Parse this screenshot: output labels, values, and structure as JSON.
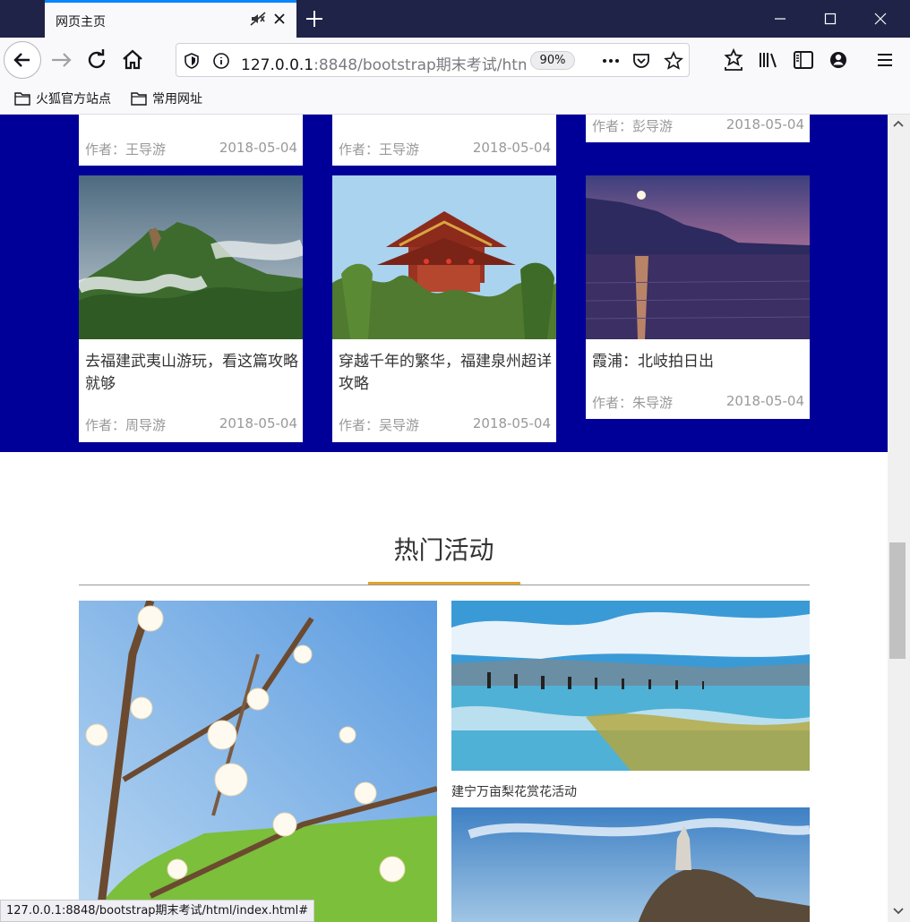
{
  "browser": {
    "tab_title": "网页主页",
    "url_host": "127.0.0.1",
    "url_rest": ":8848/bootstrap期末考试/htm",
    "zoom": "90%",
    "bookmarks": [
      "火狐官方站点",
      "常用网址"
    ],
    "status_url": "127.0.0.1:8848/bootstrap期末考试/html/index.html#"
  },
  "articles_top": [
    {
      "author": "作者：王导游",
      "date": "2018-05-04"
    },
    {
      "author": "作者：王导游",
      "date": "2018-05-04"
    },
    {
      "author": "作者：彭导游",
      "date": "2018-05-04"
    }
  ],
  "articles": [
    {
      "title": "去福建武夷山游玩，看这篇攻略就够",
      "author": "作者：周导游",
      "date": "2018-05-04"
    },
    {
      "title": "穿越千年的繁华，福建泉州超详攻略",
      "author": "作者：吴导游",
      "date": "2018-05-04"
    },
    {
      "title": "霞浦：北岐拍日出",
      "author": "作者：朱导游",
      "date": "2018-05-04"
    }
  ],
  "activities": {
    "section_title": "热门活动",
    "captions": [
      "建宁万亩梨花赏花活动"
    ]
  }
}
